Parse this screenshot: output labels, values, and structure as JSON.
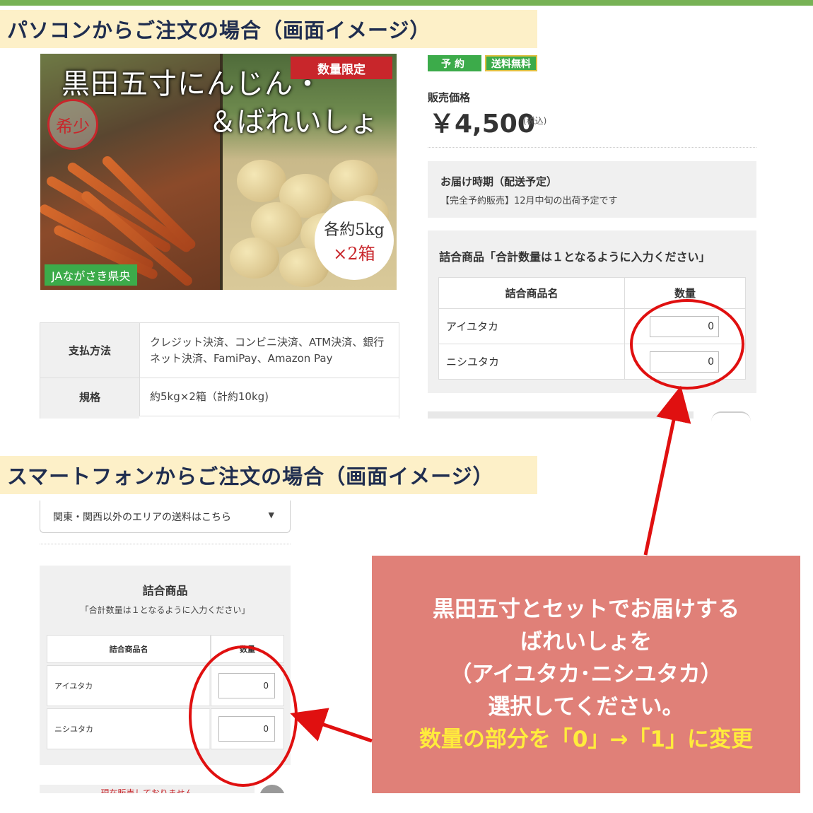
{
  "sections": {
    "pc_heading": "パソコンからご注文の場合（画面イメージ）",
    "sp_heading": "スマートフォンからご注文の場合（画面イメージ）"
  },
  "product_image": {
    "title_line1": "黒田五寸にんじん・",
    "title_line2": "＆ばれいしょ",
    "limited_badge": "数量限定",
    "rare_stamp": "希少",
    "weight_line1": "各約5kg",
    "weight_line2": "×2箱",
    "producer_badge": "JAながさき県央"
  },
  "pc": {
    "badges": {
      "reserve": "予約",
      "free_shipping": "送料無料"
    },
    "price_label": "販売価格",
    "price": "￥4,500",
    "tax_note": "(税込)",
    "delivery": {
      "label": "お届け時期（配送予定）",
      "text": "【完全予約販売】12月中旬の出荷予定です"
    },
    "assortment": {
      "title": "詰合商品「合計数量は１となるように入力ください」",
      "col_name": "詰合商品名",
      "col_qty": "数量",
      "rows": [
        {
          "name": "アイユタカ",
          "qty": "0"
        },
        {
          "name": "ニシユタカ",
          "qty": "0"
        }
      ]
    },
    "info_table": [
      {
        "label": "支払方法",
        "value": "クレジット決済、コンビニ決済、ATM決済、銀行ネット決済、FamiPay、Amazon Pay"
      },
      {
        "label": "規格",
        "value": "約5kg×2箱（計約10kg)"
      }
    ]
  },
  "sp": {
    "shipping_select": "関東・関西以外のエリアの送料はこちら",
    "assortment": {
      "title": "詰合商品",
      "subtitle": "「合計数量は１となるように入力ください」",
      "col_name": "詰合商品名",
      "col_qty": "数量",
      "rows": [
        {
          "name": "アイユタカ",
          "qty": "0"
        },
        {
          "name": "ニシユタカ",
          "qty": "0"
        }
      ]
    },
    "soldout_text": "現在販売しておりません"
  },
  "annotation": {
    "lines": [
      "黒田五寸とセットでお届けする",
      "ばれいしょを",
      "（アイユタカ･ニシユタカ）",
      "選択してください。"
    ],
    "highlight": "数量の部分を「0」→「1」に変更"
  },
  "colors": {
    "topbar": "#77b255",
    "heading_bg": "#fdf0c8",
    "heading_text": "#1f2d4f",
    "badge_green": "#3cab4a",
    "limited_red": "#c8262b",
    "annotation_bg": "#e08078",
    "annotation_highlight": "#ffec3c",
    "marker_red": "#e01010"
  }
}
